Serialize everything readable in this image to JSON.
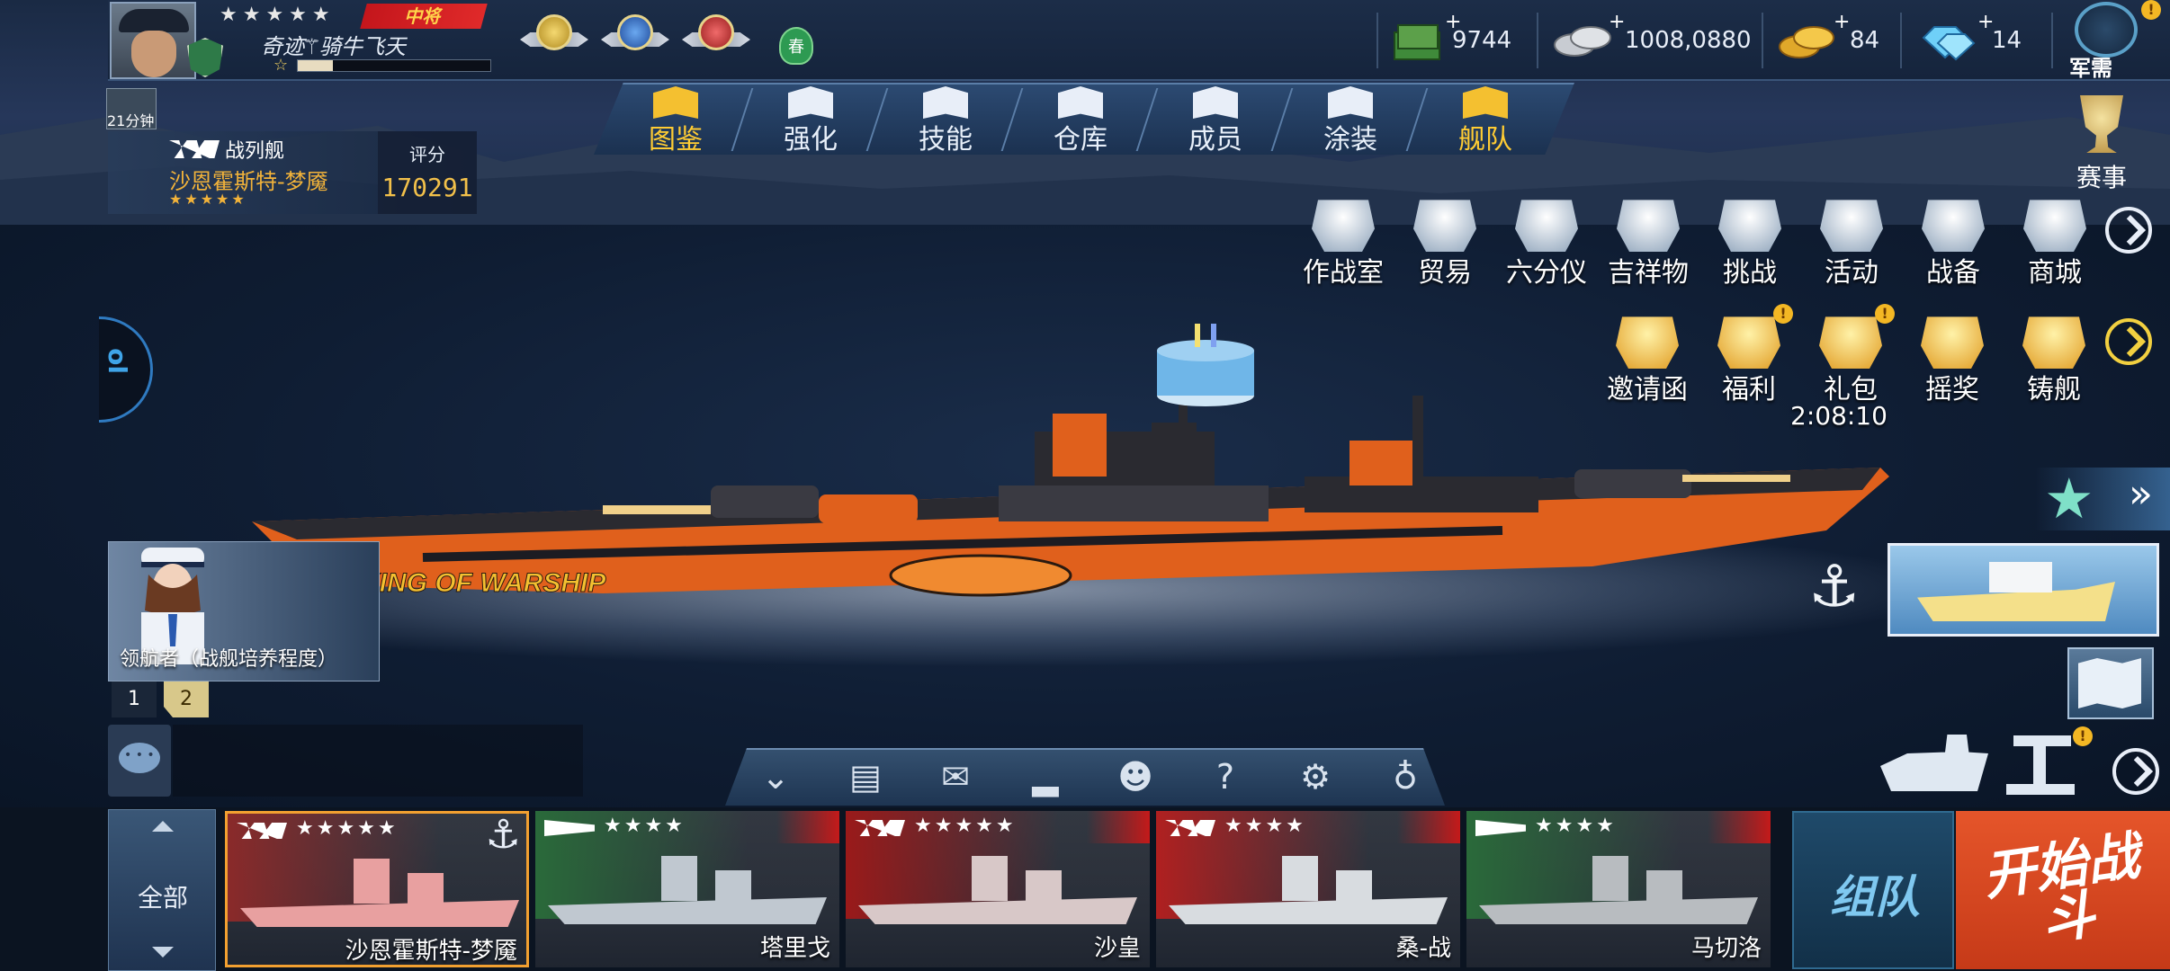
{
  "player": {
    "name": "奇迹⚚骑牛飞天",
    "rank": "中将",
    "stars": "★★★★★",
    "level_star": "☆",
    "exp_fraction": 0.18
  },
  "season_tag": "春",
  "resources": [
    {
      "id": "cash",
      "value": "9744",
      "plus": "+"
    },
    {
      "id": "silver",
      "value": "1008,0880",
      "plus": "+"
    },
    {
      "id": "gold",
      "value": "84",
      "plus": "+"
    },
    {
      "id": "diamond",
      "value": "14",
      "plus": "+"
    }
  ],
  "military": {
    "label": "军需",
    "badge": "!"
  },
  "main_nav": [
    {
      "label": "图鉴",
      "icon": "book-icon",
      "gold": true
    },
    {
      "label": "强化",
      "icon": "upgrade-icon",
      "gold": false
    },
    {
      "label": "技能",
      "icon": "skill-icon",
      "gold": false
    },
    {
      "label": "仓库",
      "icon": "warehouse-icon",
      "gold": false
    },
    {
      "label": "成员",
      "icon": "crew-icon",
      "gold": false
    },
    {
      "label": "涂装",
      "icon": "paint-flag-icon",
      "gold": false
    },
    {
      "label": "舰队",
      "icon": "fleet-icon",
      "gold": true
    }
  ],
  "ship_panel": {
    "time_left": "21分钟",
    "ship_class": "战列舰",
    "ship_name": "沙恩霍斯特-梦魇",
    "stars": "★★★★★",
    "score_label": "评分",
    "score": "170291"
  },
  "features_row1": [
    {
      "label": "作战室",
      "icon": "war-room-icon"
    },
    {
      "label": "贸易",
      "icon": "trade-scale-icon"
    },
    {
      "label": "六分仪",
      "icon": "sextant-icon"
    },
    {
      "label": "吉祥物",
      "icon": "mascot-icon"
    },
    {
      "label": "挑战",
      "icon": "challenge-icon"
    },
    {
      "label": "活动",
      "icon": "megaphone-icon"
    },
    {
      "label": "战备",
      "icon": "readiness-icon"
    },
    {
      "label": "商城",
      "icon": "shopping-cart-icon"
    }
  ],
  "features_row2": [
    {
      "label": "邀请函",
      "icon": "invitation-icon",
      "badge": ""
    },
    {
      "label": "福利",
      "icon": "welfare-chest-icon",
      "badge": "!"
    },
    {
      "label": "礼包",
      "icon": "gift-pack-icon",
      "badge": "!"
    },
    {
      "label": "摇奖",
      "icon": "lottery-wheel-icon",
      "badge": ""
    },
    {
      "label": "铸舰",
      "icon": "forge-ship-icon",
      "badge": ""
    }
  ],
  "gift_timer": "2:08:10",
  "event": {
    "label": "赛事"
  },
  "side_tab": "ol",
  "ship_decal": "KING OF WARSHIP",
  "captain": {
    "label": "领航者（战舰培养程度）"
  },
  "pages": [
    "1",
    "2"
  ],
  "toolbar": [
    {
      "icon": "collapse-chevrons-icon",
      "glyph": "⌄"
    },
    {
      "icon": "clipboard-icon",
      "glyph": "▤"
    },
    {
      "icon": "mail-icon",
      "glyph": "✉"
    },
    {
      "icon": "ranking-icon",
      "glyph": "▂"
    },
    {
      "icon": "friends-icon",
      "glyph": "☻"
    },
    {
      "icon": "help-icon",
      "glyph": "?"
    },
    {
      "icon": "settings-gear-icon",
      "glyph": "⚙"
    },
    {
      "icon": "hint-bulb-icon",
      "glyph": "♁"
    }
  ],
  "filter": {
    "label": "全部"
  },
  "roster": [
    {
      "name": "沙恩霍斯特-梦魇",
      "stars": "★★★★★",
      "class": "battleship",
      "active": true,
      "flag": "#8a2a2a",
      "hull": "#e8a0a0"
    },
    {
      "name": "塔里戈",
      "stars": "★★★★",
      "class": "submarine",
      "active": false,
      "flag": "#2a6a3a",
      "hull": "#c0c8d0"
    },
    {
      "name": "沙皇",
      "stars": "★★★★★",
      "class": "battleship",
      "active": false,
      "flag": "#9a1a1a",
      "hull": "#d8c8c8"
    },
    {
      "name": "桑-战",
      "stars": "★★★★",
      "class": "battleship",
      "active": false,
      "flag": "#b02020",
      "hull": "#d8dce0"
    },
    {
      "name": "马切洛",
      "stars": "★★★★",
      "class": "submarine",
      "active": false,
      "flag": "#2a6a3a",
      "hull": "#b8bcc0"
    }
  ],
  "team_btn": "组队",
  "battle_btn": "开始战斗",
  "colors": {
    "accent_gold": "#f2b33a",
    "battle_orange": "#e5552a",
    "team_blue": "#1f4a6a"
  }
}
